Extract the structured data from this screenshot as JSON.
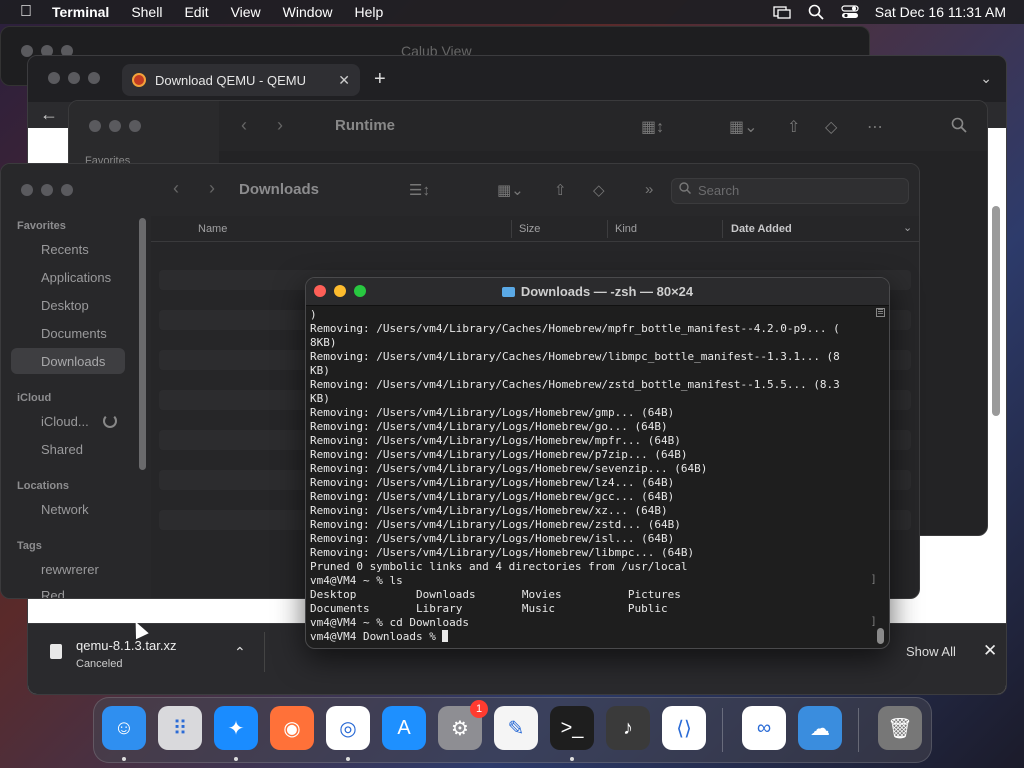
{
  "menubar": {
    "app_name": "Terminal",
    "menus": [
      "Shell",
      "Edit",
      "View",
      "Window",
      "Help"
    ],
    "datetime": "Sat Dec 16  11:31 AM"
  },
  "back_window": {
    "title": "Calub View"
  },
  "browser": {
    "tab_title": "Download QEMU - QEMU",
    "tab_close": "✕",
    "new_tab": "+",
    "download": {
      "filename": "qemu-8.1.3.tar.xz",
      "status": "Canceled",
      "show_all": "Show All"
    }
  },
  "finder_runtime": {
    "title": "Runtime",
    "sidebar_heading": "Favorites"
  },
  "finder_downloads": {
    "title": "Downloads",
    "search_placeholder": "Search",
    "columns": {
      "name": "Name",
      "size": "Size",
      "kind": "Kind",
      "date_added": "Date Added"
    },
    "sidebar": {
      "favorites_heading": "Favorites",
      "favorites": [
        "Recents",
        "Applications",
        "Desktop",
        "Documents",
        "Downloads"
      ],
      "icloud_heading": "iCloud",
      "icloud": [
        "iCloud...",
        "Shared"
      ],
      "locations_heading": "Locations",
      "locations": [
        "Network"
      ],
      "tags_heading": "Tags",
      "tags": [
        "rewwrerer",
        "Red"
      ]
    }
  },
  "terminal": {
    "title": "Downloads — -zsh — 80×24",
    "lines": [
      ")",
      "Removing: /Users/vm4/Library/Caches/Homebrew/mpfr_bottle_manifest--4.2.0-p9... (",
      "8KB)",
      "Removing: /Users/vm4/Library/Caches/Homebrew/libmpc_bottle_manifest--1.3.1... (8",
      "KB)",
      "Removing: /Users/vm4/Library/Caches/Homebrew/zstd_bottle_manifest--1.5.5... (8.3",
      "KB)",
      "Removing: /Users/vm4/Library/Logs/Homebrew/gmp... (64B)",
      "Removing: /Users/vm4/Library/Logs/Homebrew/go... (64B)",
      "Removing: /Users/vm4/Library/Logs/Homebrew/mpfr... (64B)",
      "Removing: /Users/vm4/Library/Logs/Homebrew/p7zip... (64B)",
      "Removing: /Users/vm4/Library/Logs/Homebrew/sevenzip... (64B)",
      "Removing: /Users/vm4/Library/Logs/Homebrew/lz4... (64B)",
      "Removing: /Users/vm4/Library/Logs/Homebrew/gcc... (64B)",
      "Removing: /Users/vm4/Library/Logs/Homebrew/xz... (64B)",
      "Removing: /Users/vm4/Library/Logs/Homebrew/zstd... (64B)",
      "Removing: /Users/vm4/Library/Logs/Homebrew/isl... (64B)",
      "Removing: /Users/vm4/Library/Logs/Homebrew/libmpc... (64B)",
      "Pruned 0 symbolic links and 4 directories from /usr/local",
      "vm4@VM4 ~ % ls",
      "Desktop         Downloads       Movies          Pictures",
      "Documents       Library         Music           Public",
      "vm4@VM4 ~ % cd Downloads",
      "vm4@VM4 Downloads % "
    ]
  },
  "dock": {
    "items": [
      {
        "name": "finder",
        "icon": "finder-icon",
        "color": "#2f8ff0",
        "running": true
      },
      {
        "name": "launchpad",
        "icon": "launchpad-icon",
        "color": "#d9d9dc",
        "running": false
      },
      {
        "name": "safari",
        "icon": "safari-icon",
        "color": "#1a8cff",
        "running": true
      },
      {
        "name": "firefox",
        "icon": "firefox-icon",
        "color": "#ff7139",
        "running": false
      },
      {
        "name": "chrome",
        "icon": "chrome-icon",
        "color": "#ffffff",
        "running": true
      },
      {
        "name": "app-store",
        "icon": "app-store-icon",
        "color": "#1e90ff",
        "running": false
      },
      {
        "name": "system-settings",
        "icon": "gear-icon",
        "color": "#8e8e93",
        "running": false,
        "badge": "1"
      },
      {
        "name": "textedit",
        "icon": "textedit-icon",
        "color": "#f5f5f5",
        "running": false
      },
      {
        "name": "terminal",
        "icon": "terminal-icon",
        "color": "#1e1e1e",
        "running": true
      },
      {
        "name": "instruments",
        "icon": "guitar-icon",
        "color": "#3a3a3a",
        "running": false
      },
      {
        "name": "vscode",
        "icon": "vscode-icon",
        "color": "#ffffff",
        "running": false
      },
      {
        "name": "visual-studio",
        "icon": "visual-studio-icon",
        "color": "#ffffff",
        "running": false
      },
      {
        "name": "weather",
        "icon": "weather-icon",
        "color": "#3a8dde",
        "running": false
      },
      {
        "name": "trash",
        "icon": "trash-icon",
        "color": "#777777",
        "running": false
      }
    ]
  }
}
